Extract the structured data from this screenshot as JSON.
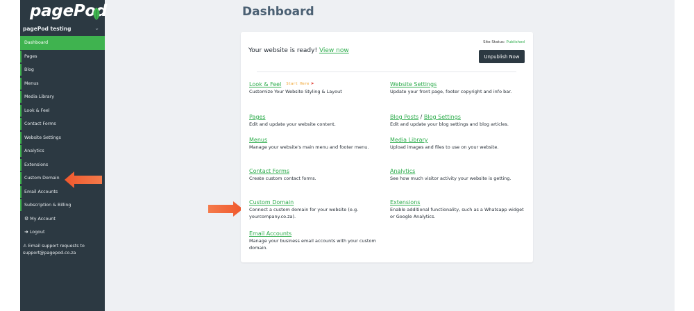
{
  "sidebar": {
    "logo": "pagePod",
    "site_name": "pagePod testing",
    "items": [
      {
        "label": "Dashboard"
      },
      {
        "label": "Pages"
      },
      {
        "label": "Blog"
      },
      {
        "label": "Menus"
      },
      {
        "label": "Media Library"
      },
      {
        "label": "Look & Feel"
      },
      {
        "label": "Contact Forms"
      },
      {
        "label": "Website Settings"
      },
      {
        "label": "Analytics"
      },
      {
        "label": "Extensions"
      },
      {
        "label": "Custom Domain"
      },
      {
        "label": "Email Accounts"
      },
      {
        "label": "Subscription & Billing"
      },
      {
        "label": "My Account"
      },
      {
        "label": "Logout"
      }
    ],
    "support_text": "Email support requests to support@pagepod.co.za"
  },
  "header": {
    "title": "Dashboard"
  },
  "card": {
    "ready_text": "Your website is ready!",
    "view_now": "View now",
    "site_status_label": "Site Status:",
    "site_status_value": "Published",
    "unpublish_label": "Unpublish Now",
    "start_here": "Start Here",
    "items": {
      "look_feel": {
        "title": "Look & Feel",
        "desc": "Customize Your Website Styling & Layout"
      },
      "website_settings": {
        "title": "Website Settings",
        "desc": "Update your front page, footer copyright and info bar."
      },
      "pages": {
        "title": "Pages",
        "desc": "Edit and update your website content."
      },
      "blog": {
        "title": "Blog Posts",
        "sep": " / ",
        "title2": "Blog Settings",
        "desc": "Edit and update your blog settings and blog articles."
      },
      "menus": {
        "title": "Menus",
        "desc": "Manage your website's main menu and footer menu."
      },
      "media": {
        "title": "Media Library",
        "desc": "Upload images and files to use on your website."
      },
      "contact": {
        "title": "Contact Forms",
        "desc": "Create custom contact forms."
      },
      "analytics": {
        "title": "Analytics",
        "desc": "See how much visitor activity your website is getting."
      },
      "domain": {
        "title": "Custom Domain",
        "desc": "Connect a custom domain for your website (e.g. yourcompany.co.za)."
      },
      "extensions": {
        "title": "Extensions",
        "desc": "Enable additional functionality, such as a Whatsapp widget or Google Analytics."
      },
      "email": {
        "title": "Email Accounts",
        "desc": "Manage your business email accounts with your custom domain."
      }
    }
  },
  "colors": {
    "sidebar": "#2c3942",
    "accent": "#3fb34f",
    "link": "#2bab4a",
    "arrow": "#f0582d"
  }
}
